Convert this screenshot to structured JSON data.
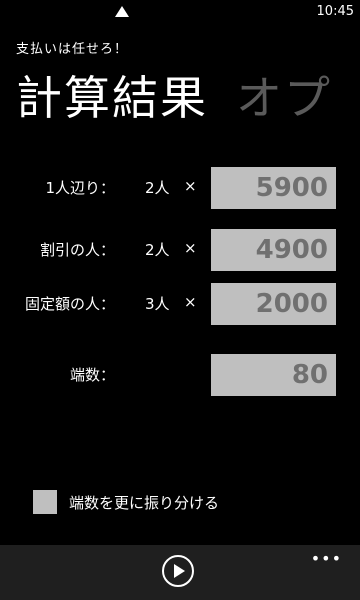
{
  "status": {
    "time": "10:45"
  },
  "app_title": "支払いは任せろ！",
  "pivot": {
    "active": "計算結果",
    "inactive": "オプ"
  },
  "rows": [
    {
      "label": "1人辺り：",
      "count": "2人",
      "times": "×",
      "value": "5900"
    },
    {
      "label": "割引の人：",
      "count": "2人",
      "times": "×",
      "value": "4900"
    },
    {
      "label": "固定額の人：",
      "count": "3人",
      "times": "×",
      "value": "2000"
    },
    {
      "label": "端数：",
      "count": "",
      "times": "",
      "value": "80"
    }
  ],
  "checkbox": {
    "label": "端数を更に振り分ける",
    "checked": false
  },
  "app_bar": {
    "more": "•••",
    "play_icon": "play-icon"
  },
  "colors": {
    "background": "#000000",
    "box": "#bfbfbf",
    "box_text": "#707070",
    "inactive_pivot": "#5a5a5a",
    "app_bar": "#1f1f1f"
  }
}
